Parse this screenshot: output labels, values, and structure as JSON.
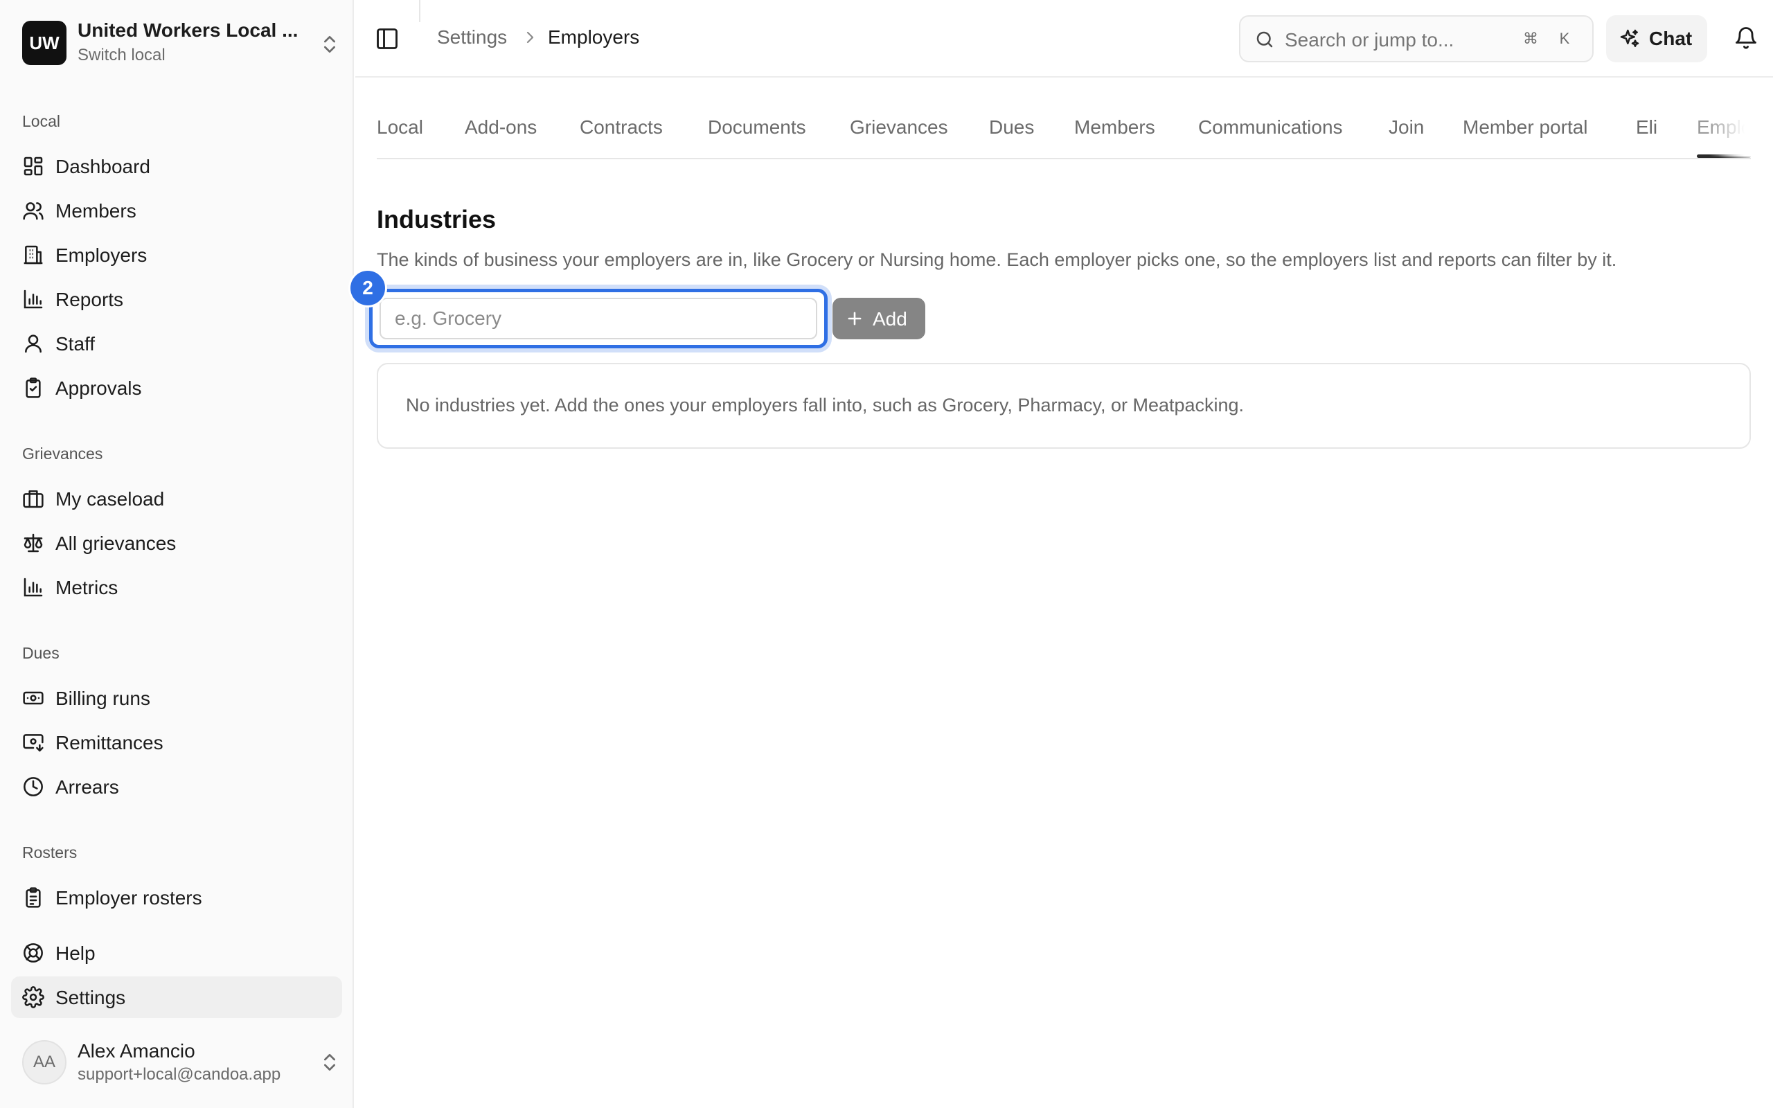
{
  "org": {
    "initials": "UW",
    "name": "United Workers Local ...",
    "switch_label": "Switch local"
  },
  "sidebar": {
    "sections": {
      "local": "Local",
      "grievances": "Grievances",
      "dues": "Dues",
      "rosters": "Rosters"
    },
    "items": {
      "dashboard": "Dashboard",
      "members": "Members",
      "employers": "Employers",
      "reports": "Reports",
      "staff": "Staff",
      "approvals": "Approvals",
      "my_caseload": "My caseload",
      "all_grievances": "All grievances",
      "metrics": "Metrics",
      "billing_runs": "Billing runs",
      "remittances": "Remittances",
      "arrears": "Arrears",
      "employer_rosters": "Employer rosters",
      "help": "Help",
      "settings": "Settings"
    }
  },
  "user": {
    "initials": "AA",
    "name": "Alex Amancio",
    "email": "support+local@candoa.app"
  },
  "header": {
    "breadcrumb_parent": "Settings",
    "breadcrumb_current": "Employers",
    "search_placeholder": "Search or jump to...",
    "search_shortcut_1": "⌘",
    "search_shortcut_2": "K",
    "chat_label": "Chat"
  },
  "tabs": {
    "local": "Local",
    "addons": "Add-ons",
    "contracts": "Contracts",
    "documents": "Documents",
    "grievances": "Grievances",
    "dues": "Dues",
    "members": "Members",
    "communications": "Communications",
    "join": "Join",
    "member_portal": "Member portal",
    "eli": "Eli",
    "employers": "Employers"
  },
  "industries": {
    "title": "Industries",
    "description": "The kinds of business your employers are in, like Grocery or Nursing home. Each employer picks one, so the employers list and reports can filter by it.",
    "input_placeholder": "e.g. Grocery",
    "input_value": "",
    "step_badge": "2",
    "add_label": "Add",
    "empty_text": "No industries yet. Add the ones your employers fall into, such as Grocery, Pharmacy, or Meatpacking."
  },
  "colors": {
    "accent": "#2f6fe4",
    "add_button": "#858585",
    "sidebar_bg": "#fafafa"
  }
}
